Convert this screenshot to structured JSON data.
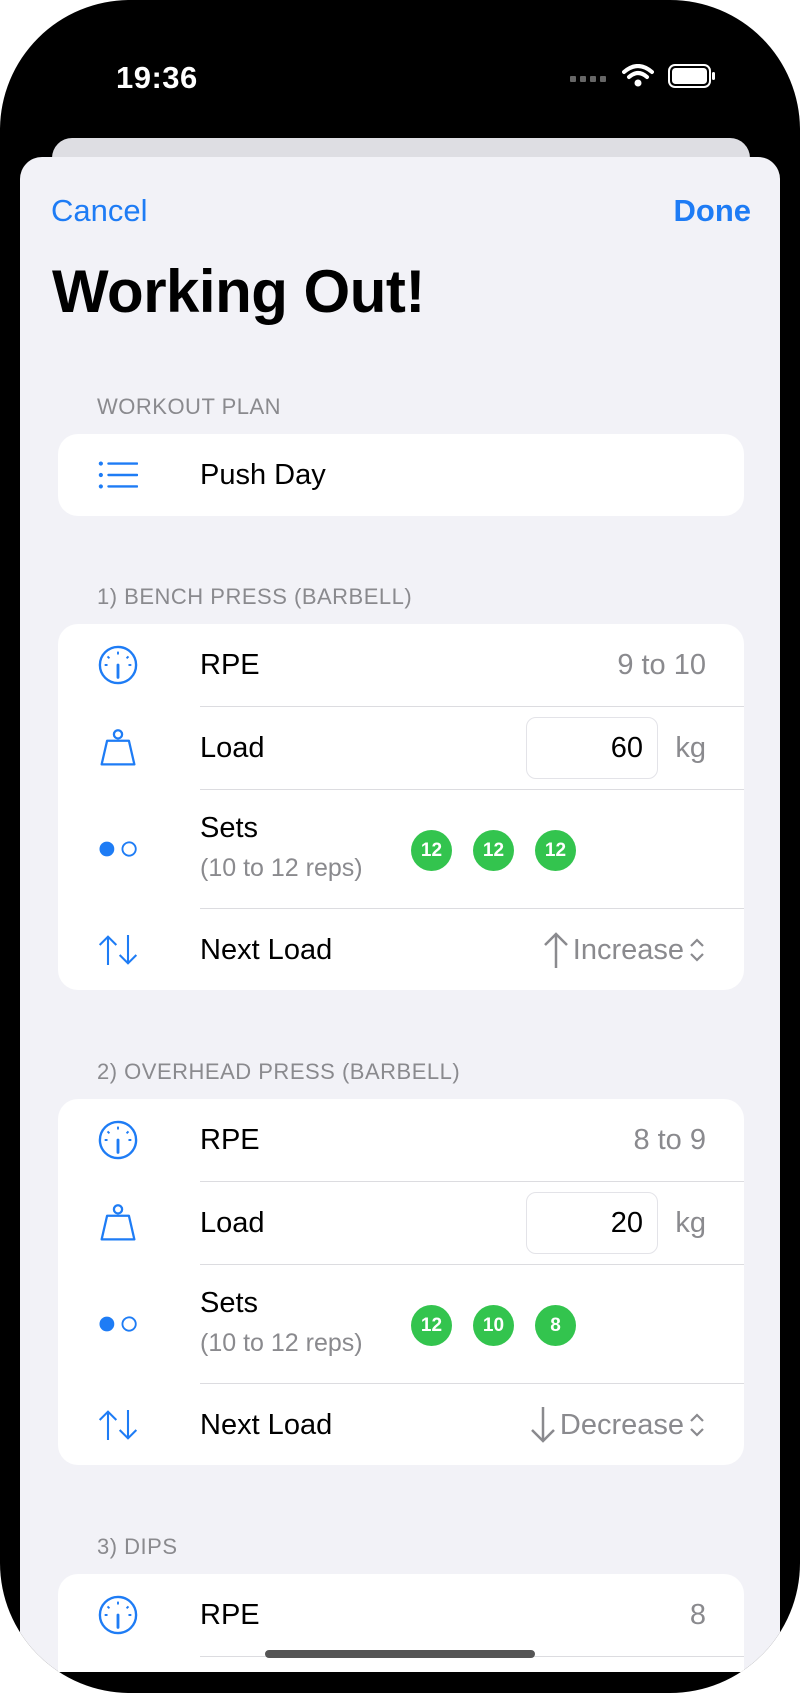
{
  "status": {
    "time": "19:36"
  },
  "nav": {
    "cancel_label": "Cancel",
    "done_label": "Done"
  },
  "page": {
    "title": "Working Out!"
  },
  "workout_plan": {
    "header": "WORKOUT PLAN",
    "name": "Push Day",
    "icon": "list-icon"
  },
  "exercises": [
    {
      "header": "1) BENCH PRESS (BARBELL)",
      "rpe_label": "RPE",
      "rpe_value": "9 to 10",
      "load_label": "Load",
      "load_value": "60",
      "load_unit": "kg",
      "sets_label": "Sets",
      "sets_sub": "(10 to 12 reps)",
      "sets": [
        "12",
        "12",
        "12"
      ],
      "next_label": "Next Load",
      "next_value": "Increase",
      "next_direction": "up"
    },
    {
      "header": "2) OVERHEAD PRESS (BARBELL)",
      "rpe_label": "RPE",
      "rpe_value": "8 to 9",
      "load_label": "Load",
      "load_value": "20",
      "load_unit": "kg",
      "sets_label": "Sets",
      "sets_sub": "(10 to 12 reps)",
      "sets": [
        "12",
        "10",
        "8"
      ],
      "next_label": "Next Load",
      "next_value": "Decrease",
      "next_direction": "down"
    },
    {
      "header": "3) DIPS",
      "rpe_label": "RPE",
      "rpe_value": "8"
    }
  ],
  "colors": {
    "accent": "#1e7cf5",
    "set_badge": "#33c44e",
    "background": "#f2f2f7",
    "secondary_text": "#8a8a8e"
  }
}
